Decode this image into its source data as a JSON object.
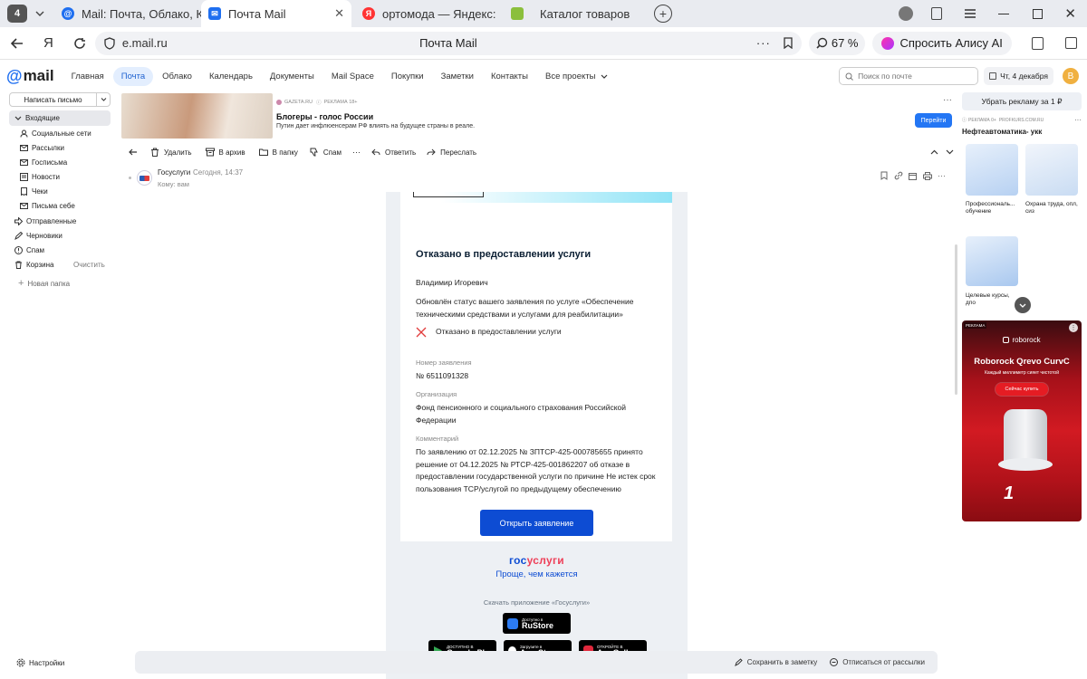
{
  "browser": {
    "tab_count": "4",
    "tabs": [
      {
        "label": "Mail: Почта, Облако, Кале"
      },
      {
        "label": "Почта Mail"
      },
      {
        "label": "ортомода — Яндекс: наш"
      },
      {
        "label": "Каталог товаров"
      }
    ],
    "url": "e.mail.ru",
    "page_title": "Почта Mail",
    "zoom": "67 %",
    "alice": "Спросить Алису AI"
  },
  "app": {
    "logo": "mail",
    "nav": [
      "Главная",
      "Почта",
      "Облако",
      "Календарь",
      "Документы",
      "Mail Space",
      "Покупки",
      "Заметки",
      "Контакты",
      "Все проекты"
    ],
    "search_placeholder": "Поиск по почте",
    "date": "Чт, 4 декабря",
    "avatar": "В"
  },
  "sidebar": {
    "compose": "Написать письмо",
    "inbox": "Входящие",
    "items": [
      "Социальные сети",
      "Рассылки",
      "Госписьма",
      "Новости",
      "Чеки",
      "Письма себе"
    ],
    "sent": "Отправленные",
    "drafts": "Черновики",
    "spam": "Спам",
    "trash": "Корзина",
    "clear": "Очистить",
    "new_folder": "Новая папка",
    "settings": "Настройки"
  },
  "banner": {
    "source": "GAZETA.RU",
    "ad": "РЕКЛАМА 18+",
    "title": "Блогеры - голос России",
    "text": "Путин дает инфлюенсерам РФ влиять на будущее страны в реале.",
    "button": "Перейти"
  },
  "toolbar": {
    "delete": "Удалить",
    "archive": "В архив",
    "move": "В папку",
    "spam": "Спам",
    "more": "···",
    "reply": "Ответить",
    "forward": "Переслать"
  },
  "message": {
    "sender": "Госуслуги",
    "time": "Сегодня, 14:37",
    "to": "Кому: вам",
    "heading": "Отказано в предоставлении услуги",
    "greeting": "Владимир Игоревич",
    "intro": "Обновлён статус вашего заявления по услуге «Обеспечение техническими средствами и услугами для реабилитации»",
    "status": "Отказано в предоставлении услуги",
    "number_label": "Номер заявления",
    "number": "№ 6511091328",
    "org_label": "Организация",
    "org": "Фонд пенсионного и социального страхования Российской Федерации",
    "comment_label": "Комментарий",
    "comment": "По заявлению от 02.12.2025 № ЗПТСР-425-000785655 принято решение от 04.12.2025 № РТСР-425-001862207 об отказе в предоставлении государственной услуги по причине Не истек срок пользования ТСР/услугой по предыдущему обеспечению",
    "button": "Открыть заявление",
    "brand_gos": "гос",
    "brand_uslugi": "услуги",
    "slogan": "Проще, чем кажется",
    "download": "Скачать приложение «Госуслуги»",
    "store_small": "Доступно в",
    "store": "RuStore",
    "stores_row": [
      {
        "small": "ДОСТУПНО В",
        "name": "Google Play"
      },
      {
        "small": "Загрузите в",
        "name": "App Store"
      },
      {
        "small": "ОТКРОЙТЕ В",
        "name": "AppGallery"
      }
    ]
  },
  "bottom": {
    "save": "Сохранить в заметку",
    "unsubscribe": "Отписаться от рассылки"
  },
  "right": {
    "remove_ads": "Убрать рекламу за 1 ₽",
    "ad_mark": "РЕКЛАМА 0+",
    "ad_domain": "PROFKURS.COM.RU",
    "title": "Нефтеавтоматика- укк",
    "p1": "Профессиональ... обучение",
    "p2": "Охрана труда, опл, сиз",
    "p3": "Целевые курсы, дпо",
    "roborock": {
      "ad": "РЕКЛАМА",
      "brand": "roborock",
      "title": "Roborock Qrevo CurvC",
      "sub": "Каждый миллиметр сияет чистотой",
      "button": "Сейчас купить",
      "badge": "1"
    }
  }
}
